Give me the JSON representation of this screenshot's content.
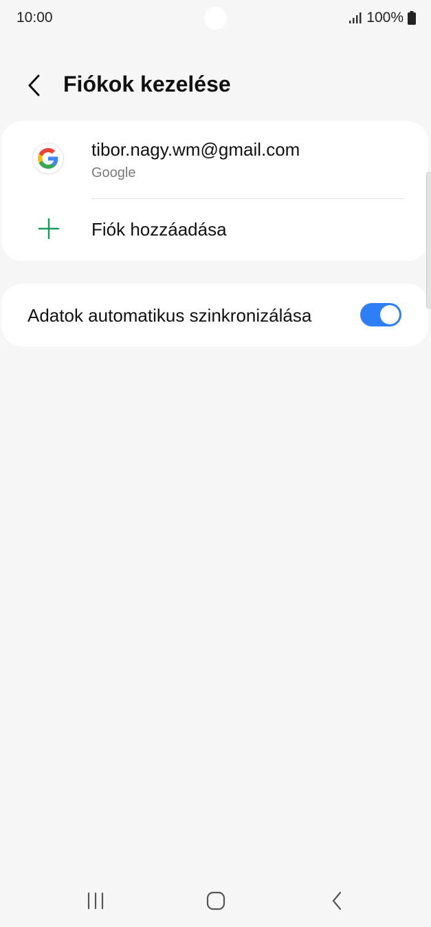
{
  "status_bar": {
    "time": "10:00",
    "battery_text": "100%",
    "signal_icon": "signal-bars-icon",
    "battery_icon": "battery-icon"
  },
  "header": {
    "title": "Fiókok kezelése",
    "back_icon": "chevron-left-icon"
  },
  "accounts": {
    "items": [
      {
        "email": "tibor.nagy.wm@gmail.com",
        "type": "Google",
        "icon": "google-icon"
      }
    ],
    "add_label": "Fiók hozzáadása",
    "add_icon": "plus-icon"
  },
  "sync": {
    "label": "Adatok automatikus szinkronizálása",
    "enabled": true
  },
  "colors": {
    "background": "#f6f6f6",
    "card": "#ffffff",
    "accent_blue": "#2d7ef7",
    "plus_green": "#1a9b5a",
    "secondary_text": "#7a7a7a"
  },
  "nav_bar": {
    "recents_icon": "recents-icon",
    "home_icon": "home-icon",
    "back_icon": "back-icon"
  }
}
